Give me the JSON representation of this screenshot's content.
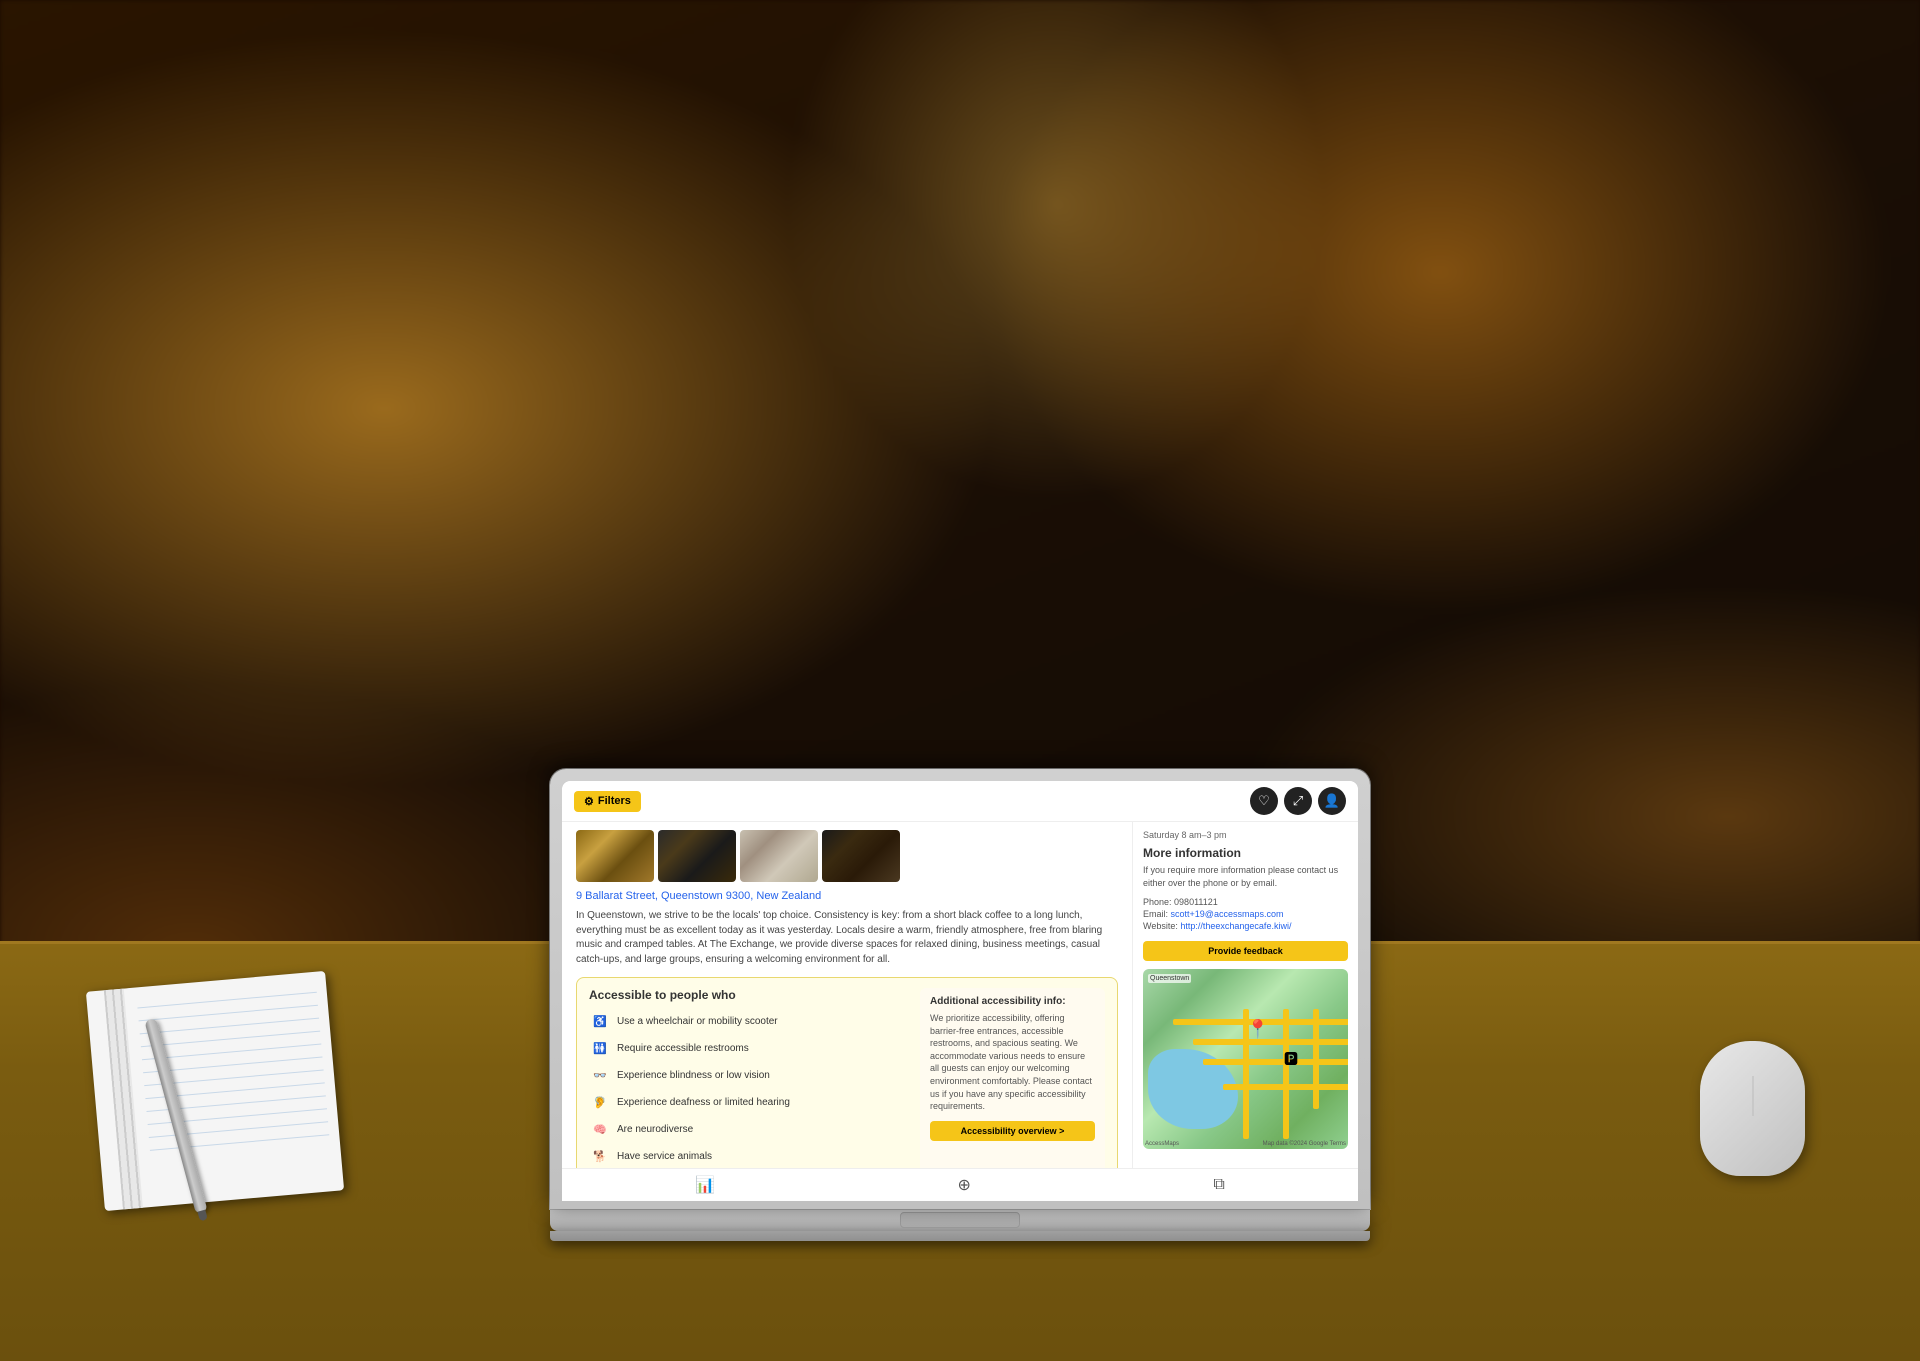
{
  "background": {
    "description": "Blurred cafe/bar bokeh background"
  },
  "app": {
    "filters_button": "Filters",
    "hours": "Saturday 8 am–3 pm",
    "address": "9 Ballarat Street, Queenstown 9300, New Zealand",
    "description": "In Queenstown, we strive to be the locals' top choice. Consistency is key: from a short black coffee to a long lunch, everything must be as excellent today as it was yesterday. Locals desire a warm, friendly atmosphere, free from blaring music and cramped tables. At The Exchange, we provide diverse spaces for relaxed dining, business meetings, casual catch-ups, and large groups, ensuring a welcoming environment for all.",
    "accessible_section": {
      "title": "Accessible to people who",
      "items": [
        {
          "label": "Use a wheelchair or mobility scooter",
          "icon": "♿"
        },
        {
          "label": "Require accessible restrooms",
          "icon": "🚻"
        },
        {
          "label": "Experience blindness or low vision",
          "icon": "👓"
        },
        {
          "label": "Experience deafness or limited hearing",
          "icon": "🦻"
        },
        {
          "label": "Are neurodiverse",
          "icon": "🧠"
        },
        {
          "label": "Have service animals",
          "icon": "🐕"
        }
      ]
    },
    "additional_info": {
      "title": "Additional accessibility info:",
      "text": "We prioritize accessibility, offering barrier-free entrances, accessible restrooms, and spacious seating. We accommodate various needs to ensure all guests can enjoy our welcoming environment comfortably. Please contact us if you have any specific accessibility requirements.",
      "button": "Accessibility overview >"
    },
    "more_info": {
      "title": "More information",
      "description": "If you require more information please contact us either over the phone or by email.",
      "phone_label": "Phone:",
      "phone": "098011121",
      "email_label": "Email:",
      "email": "scott+19@accessmaps.com",
      "website_label": "Website:",
      "website": "http://theexchangecafe.kiwi/",
      "feedback_button": "Provide feedback"
    },
    "map": {
      "attribution": "AccessMaps",
      "attribution_right": "Map data ©2024 Google  Terms"
    },
    "bottom_icons": [
      "📊",
      "⊙",
      "⧉"
    ]
  }
}
